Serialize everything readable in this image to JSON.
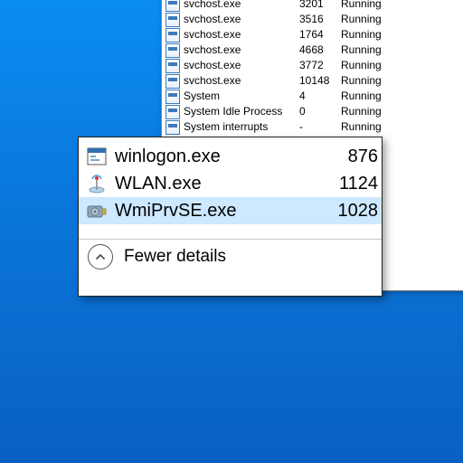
{
  "background": {
    "processes": [
      {
        "name": "svchost.exe",
        "pid": "3201",
        "status": "Running"
      },
      {
        "name": "svchost.exe",
        "pid": "3516",
        "status": "Running"
      },
      {
        "name": "svchost.exe",
        "pid": "1764",
        "status": "Running"
      },
      {
        "name": "svchost.exe",
        "pid": "4668",
        "status": "Running"
      },
      {
        "name": "svchost.exe",
        "pid": "3772",
        "status": "Running"
      },
      {
        "name": "svchost.exe",
        "pid": "10148",
        "status": "Running"
      },
      {
        "name": "System",
        "pid": "4",
        "status": "Running"
      },
      {
        "name": "System Idle Process",
        "pid": "0",
        "status": "Running"
      },
      {
        "name": "System interrupts",
        "pid": "-",
        "status": "Running"
      }
    ]
  },
  "popup": {
    "items": [
      {
        "name": "winlogon.exe",
        "pid": "876",
        "icon": "app",
        "selected": false
      },
      {
        "name": "WLAN.exe",
        "pid": "1124",
        "icon": "wlan",
        "selected": false
      },
      {
        "name": "WmiPrvSE.exe",
        "pid": "1028",
        "icon": "wmi",
        "selected": true
      }
    ],
    "footer_label": "Fewer details"
  }
}
